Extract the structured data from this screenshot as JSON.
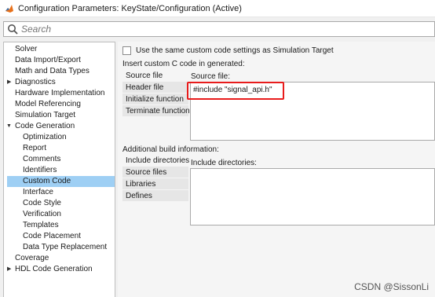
{
  "window": {
    "title": "Configuration Parameters: KeyState/Configuration (Active)"
  },
  "search": {
    "placeholder": "Search"
  },
  "tree": {
    "items": [
      {
        "label": "Solver"
      },
      {
        "label": "Data Import/Export"
      },
      {
        "label": "Math and Data Types"
      },
      {
        "label": "Diagnostics",
        "expander": "collapsed"
      },
      {
        "label": "Hardware Implementation"
      },
      {
        "label": "Model Referencing"
      },
      {
        "label": "Simulation Target"
      },
      {
        "label": "Code Generation",
        "expander": "expanded"
      },
      {
        "label": "Optimization"
      },
      {
        "label": "Report"
      },
      {
        "label": "Comments"
      },
      {
        "label": "Identifiers"
      },
      {
        "label": "Custom Code",
        "selected": true
      },
      {
        "label": "Interface"
      },
      {
        "label": "Code Style"
      },
      {
        "label": "Verification"
      },
      {
        "label": "Templates"
      },
      {
        "label": "Code Placement"
      },
      {
        "label": "Data Type Replacement"
      },
      {
        "label": "Coverage"
      },
      {
        "label": "HDL Code Generation",
        "expander": "collapsed"
      }
    ]
  },
  "custom_code": {
    "checkbox_label": "Use the same custom code settings as Simulation Target",
    "checkbox_checked": false,
    "insert_section_label": "Insert custom C code in generated:",
    "insert_tabs": [
      "Source file",
      "Header file",
      "Initialize function",
      "Terminate function"
    ],
    "active_insert_tab": "Source file",
    "source_file_label": "Source file:",
    "source_file_value": "#include \"signal_api.h\"",
    "build_section_label": "Additional build information:",
    "build_tabs": [
      "Include directories",
      "Source files",
      "Libraries",
      "Defines"
    ],
    "active_build_tab": "Include directories",
    "include_dirs_label": "Include directories:",
    "include_dirs_value": ""
  },
  "watermark": "CSDN @SissonLi",
  "colors": {
    "selection": "#9ecff4",
    "highlight_box": "#e81c1c",
    "matlab_icon": "#e8701a"
  }
}
